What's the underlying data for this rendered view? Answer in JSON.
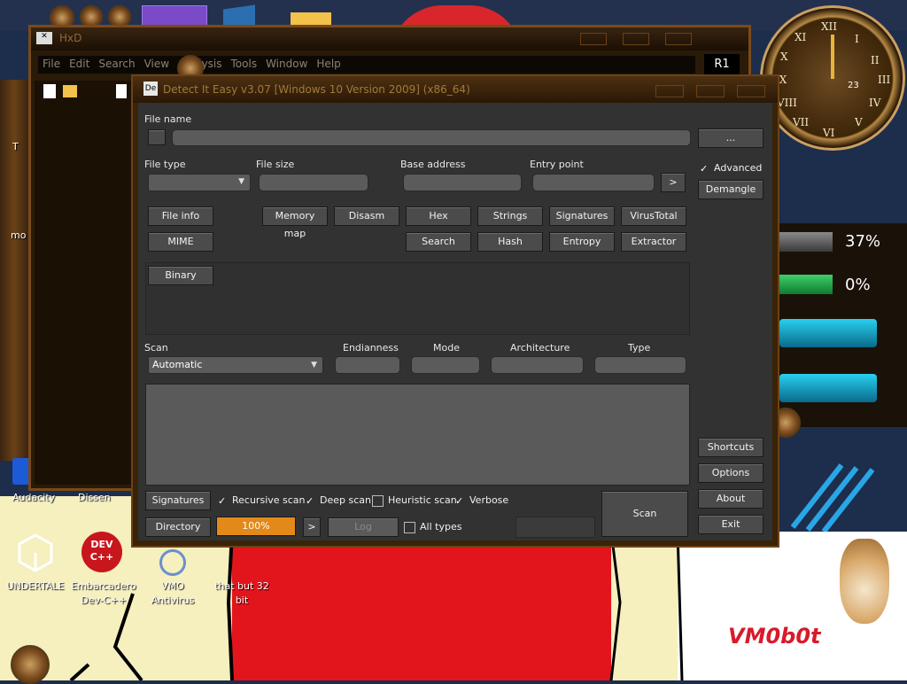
{
  "desktop_icons": {
    "audacity": "Audacity",
    "dissen": "Dissen",
    "undertale": "UNDERTALE",
    "devcpp": "Embarcadero Dev-C++",
    "devcpp_logo_line1": "DEV",
    "devcpp_logo_line2": "C++",
    "vmo": "VMO Antivirus",
    "thatbut": "that but 32 bit",
    "left_t": "T",
    "left_mo": "mo"
  },
  "gauges": {
    "top": "37%",
    "bottom": "0%"
  },
  "clock_numbers": {
    "xii": "XII",
    "i": "I",
    "ii": "II",
    "iii": "III",
    "ix": "IX",
    "x": "X",
    "xi": "XI",
    "iv": "IV",
    "v": "V",
    "vi": "VI",
    "vii": "VII",
    "viii": "VIII",
    "date": "23"
  },
  "watermark": "VM0b0t",
  "hxd": {
    "title": "HxD",
    "menu": [
      "File",
      "Edit",
      "Search",
      "View",
      "Analysis",
      "Tools",
      "Window",
      "Help"
    ],
    "badge": "R1"
  },
  "die": {
    "title": "Detect It Easy v3.07 [Windows 10 Version 2009] (x86_64)",
    "file_name_label": "File name",
    "browse_label": "...",
    "file_type_label": "File type",
    "file_size_label": "File size",
    "base_address_label": "Base address",
    "entry_point_label": "Entry point",
    "entry_go_label": ">",
    "advanced_label": "Advanced",
    "demangle_label": "Demangle",
    "buttons_row1": [
      "File info",
      "Memory map",
      "Disasm",
      "Hex",
      "Strings",
      "Signatures",
      "VirusTotal"
    ],
    "buttons_row2": [
      "MIME",
      "Search",
      "Hash",
      "Entropy",
      "Extractor"
    ],
    "binary_label": "Binary",
    "scan_label": "Scan",
    "scan_value": "Automatic",
    "endianness_label": "Endianness",
    "mode_label": "Mode",
    "architecture_label": "Architecture",
    "type_label": "Type",
    "signatures_btn": "Signatures",
    "recursive_label": "Recursive scan",
    "deep_label": "Deep scan",
    "heuristic_label": "Heuristic scan",
    "verbose_label": "Verbose",
    "directory_btn": "Directory",
    "progress_value": "100%",
    "progress_fill": 1.0,
    "next_btn": ">",
    "log_btn": "Log",
    "all_types_label": "All types",
    "scan_btn": "Scan",
    "shortcuts_btn": "Shortcuts",
    "options_btn": "Options",
    "about_btn": "About",
    "exit_btn": "Exit",
    "accent_color": "#e2891a"
  }
}
